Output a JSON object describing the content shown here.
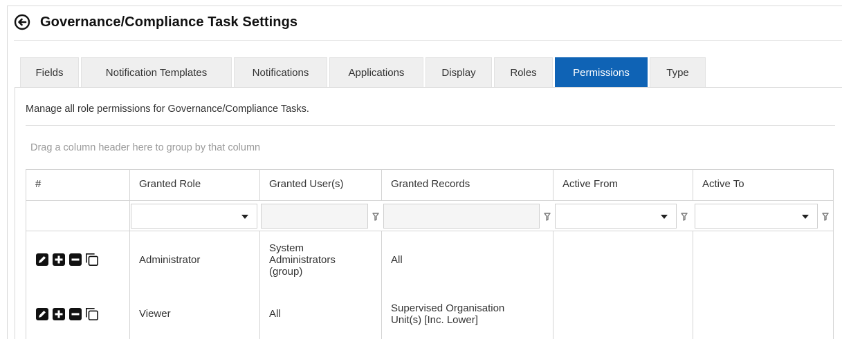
{
  "header": {
    "title": "Governance/Compliance Task Settings",
    "back_icon": "arrow-left-circle-icon"
  },
  "tabs": [
    {
      "label": "Fields",
      "active": false
    },
    {
      "label": "Notification Templates",
      "active": false
    },
    {
      "label": "Notifications",
      "active": false
    },
    {
      "label": "Applications",
      "active": false
    },
    {
      "label": "Display",
      "active": false
    },
    {
      "label": "Roles",
      "active": false
    },
    {
      "label": "Permissions",
      "active": true
    },
    {
      "label": "Type",
      "active": false
    }
  ],
  "panel": {
    "description": "Manage all role permissions for Governance/Compliance Tasks.",
    "group_hint": "Drag a column header here to group by that column"
  },
  "grid": {
    "columns": [
      "#",
      "Granted Role",
      "Granted User(s)",
      "Granted Records",
      "Active From",
      "Active To"
    ],
    "rows": [
      {
        "role": "Administrator",
        "users": "System Administrators (group)",
        "records": "All",
        "active_from": "",
        "active_to": ""
      },
      {
        "role": "Viewer",
        "users": "All",
        "records": "Supervised Organisation Unit(s) [Inc. Lower]",
        "active_from": "",
        "active_to": ""
      }
    ]
  },
  "colors": {
    "accent": "#0f63b5",
    "tab_bg": "#efefef",
    "border": "#d4d4d4"
  }
}
